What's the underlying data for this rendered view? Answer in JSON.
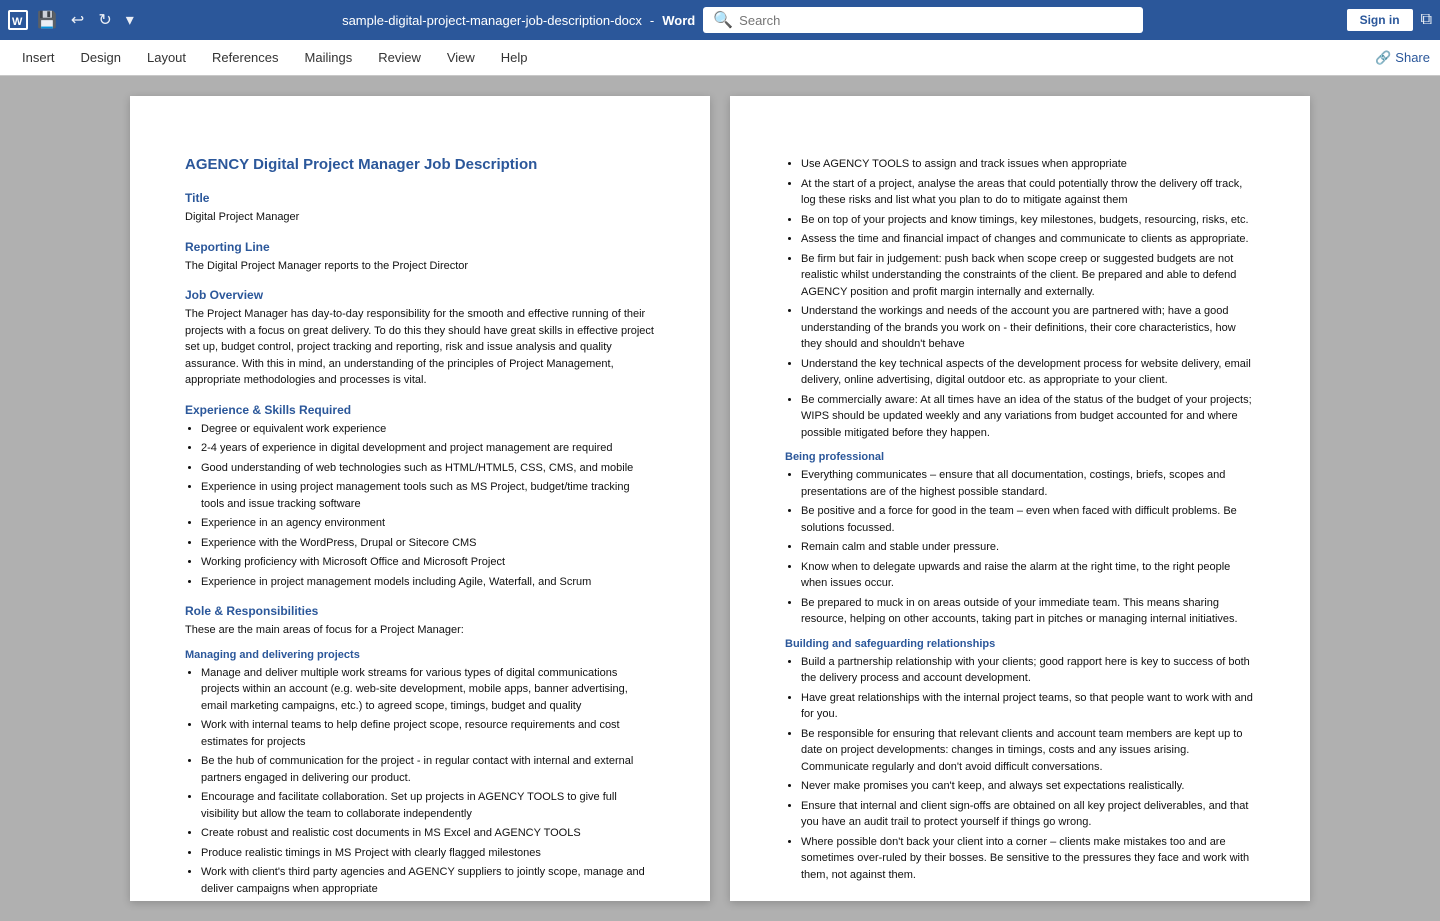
{
  "titleBar": {
    "fileName": "sample-digital-project-manager-job-description-docx",
    "separator": " - ",
    "appName": "Word",
    "searchPlaceholder": "Search",
    "signInLabel": "Sign in"
  },
  "menuBar": {
    "items": [
      "Insert",
      "Design",
      "Layout",
      "References",
      "Mailings",
      "Review",
      "View",
      "Help"
    ],
    "shareLabel": "Share"
  },
  "page1": {
    "docTitle": "AGENCY Digital Project Manager Job Description",
    "sections": [
      {
        "heading": "Title",
        "content": "Digital Project Manager",
        "type": "text"
      },
      {
        "heading": "Reporting Line",
        "content": "The Digital Project Manager reports to the Project Director",
        "type": "text"
      },
      {
        "heading": "Job Overview",
        "content": "The Project Manager has day-to-day responsibility for the smooth and effective running of their projects with a focus on great delivery. To do this they should have great skills in effective project set up, budget control, project tracking and reporting, risk and issue analysis and quality assurance. With this in mind, an understanding of the principles of Project Management, appropriate methodologies and processes is vital.",
        "type": "text"
      },
      {
        "heading": "Experience & Skills Required",
        "type": "bullets",
        "items": [
          "Degree or equivalent work experience",
          "2-4 years of experience in digital development and project management are required",
          "Good understanding of web technologies such as HTML/HTML5, CSS, CMS, and mobile",
          "Experience in using project management tools such as MS Project, budget/time tracking tools and issue tracking software",
          "Experience in an agency environment",
          "Experience with the WordPress, Drupal or Sitecore CMS",
          "Working proficiency with Microsoft Office and Microsoft Project",
          "Experience in project management models including Agile, Waterfall, and Scrum"
        ]
      },
      {
        "heading": "Role & Responsibilities",
        "content": "These are the main areas of focus for a Project Manager:",
        "type": "text"
      },
      {
        "subheading": "Managing and delivering projects",
        "type": "subbullets",
        "items": [
          "Manage and deliver multiple work streams for various types of digital communications projects within an account (e.g. web-site development, mobile apps, banner advertising, email marketing campaigns, etc.) to agreed scope, timings, budget and quality",
          "Work with internal teams to help define project scope, resource requirements and cost estimates for projects",
          "Be the hub of communication for the project - in regular contact with internal and external partners engaged in delivering our product.",
          "Encourage and facilitate collaboration. Set up projects in AGENCY TOOLS to give full visibility but allow the team to collaborate independently",
          "Create robust and realistic cost documents in MS Excel and AGENCY TOOLS",
          "Produce realistic timings in MS Project with clearly flagged milestones",
          "Work with client's third party agencies and AGENCY suppliers to jointly scope, manage and deliver campaigns when appropriate"
        ]
      }
    ]
  },
  "page2": {
    "continuedBullets": [
      "Use AGENCY TOOLS to assign and track issues when appropriate",
      "At the start of a project, analyse the areas that could potentially throw the delivery off track, log these risks and list what you plan to do to mitigate against them",
      "Be on top of your projects and know timings, key milestones, budgets, resourcing, risks, etc.",
      "Assess the time and financial impact of changes and communicate to clients as appropriate.",
      "Be firm but fair in judgement: push back when scope creep or suggested budgets are not realistic whilst understanding the constraints of the client. Be prepared and able to defend AGENCY position and profit margin internally and externally.",
      "Understand the workings and needs of the account you are partnered with; have a good understanding of the brands you work on - their definitions, their core characteristics, how they should and shouldn't behave",
      "Understand the key technical aspects of the development process for website delivery, email delivery, online advertising, digital outdoor etc. as appropriate to your client.",
      "Be commercially aware: At all times have an idea of the status of the budget of your projects; WIPS should be updated weekly and any variations from budget accounted for and where possible mitigated before they happen."
    ],
    "sections": [
      {
        "subheading": "Being professional",
        "type": "subbullets",
        "items": [
          "Everything communicates – ensure that all documentation, costings, briefs, scopes and presentations are of the highest possible standard.",
          "Be positive and a force for good in the team – even when faced with difficult problems. Be solutions focussed.",
          "Remain calm and stable under pressure.",
          "Know when to delegate upwards and raise the alarm at the right time, to the right people when issues occur.",
          "Be prepared to muck in on areas outside of your immediate team. This means sharing resource, helping on other accounts, taking part in pitches or managing internal initiatives."
        ]
      },
      {
        "subheading": "Building and safeguarding relationships",
        "type": "subbullets",
        "items": [
          "Build a partnership relationship with your clients; good rapport here is key to success of both the delivery process and account development.",
          "Have great relationships with the internal project teams, so that people want to work with and for you.",
          "Be responsible for ensuring that relevant clients and account team members are kept up to date on project developments: changes in timings, costs and any issues arising. Communicate regularly and don't avoid difficult conversations.",
          "Never make promises you can't keep, and always set expectations realistically.",
          "Ensure that internal and client sign-offs are obtained on all key project deliverables, and that you have an audit trail to protect yourself if things go wrong.",
          "Where possible don't back your client into a corner – clients make mistakes too and are sometimes over-ruled by their bosses. Be sensitive to the pressures they face and work with them, not against them."
        ]
      }
    ]
  }
}
